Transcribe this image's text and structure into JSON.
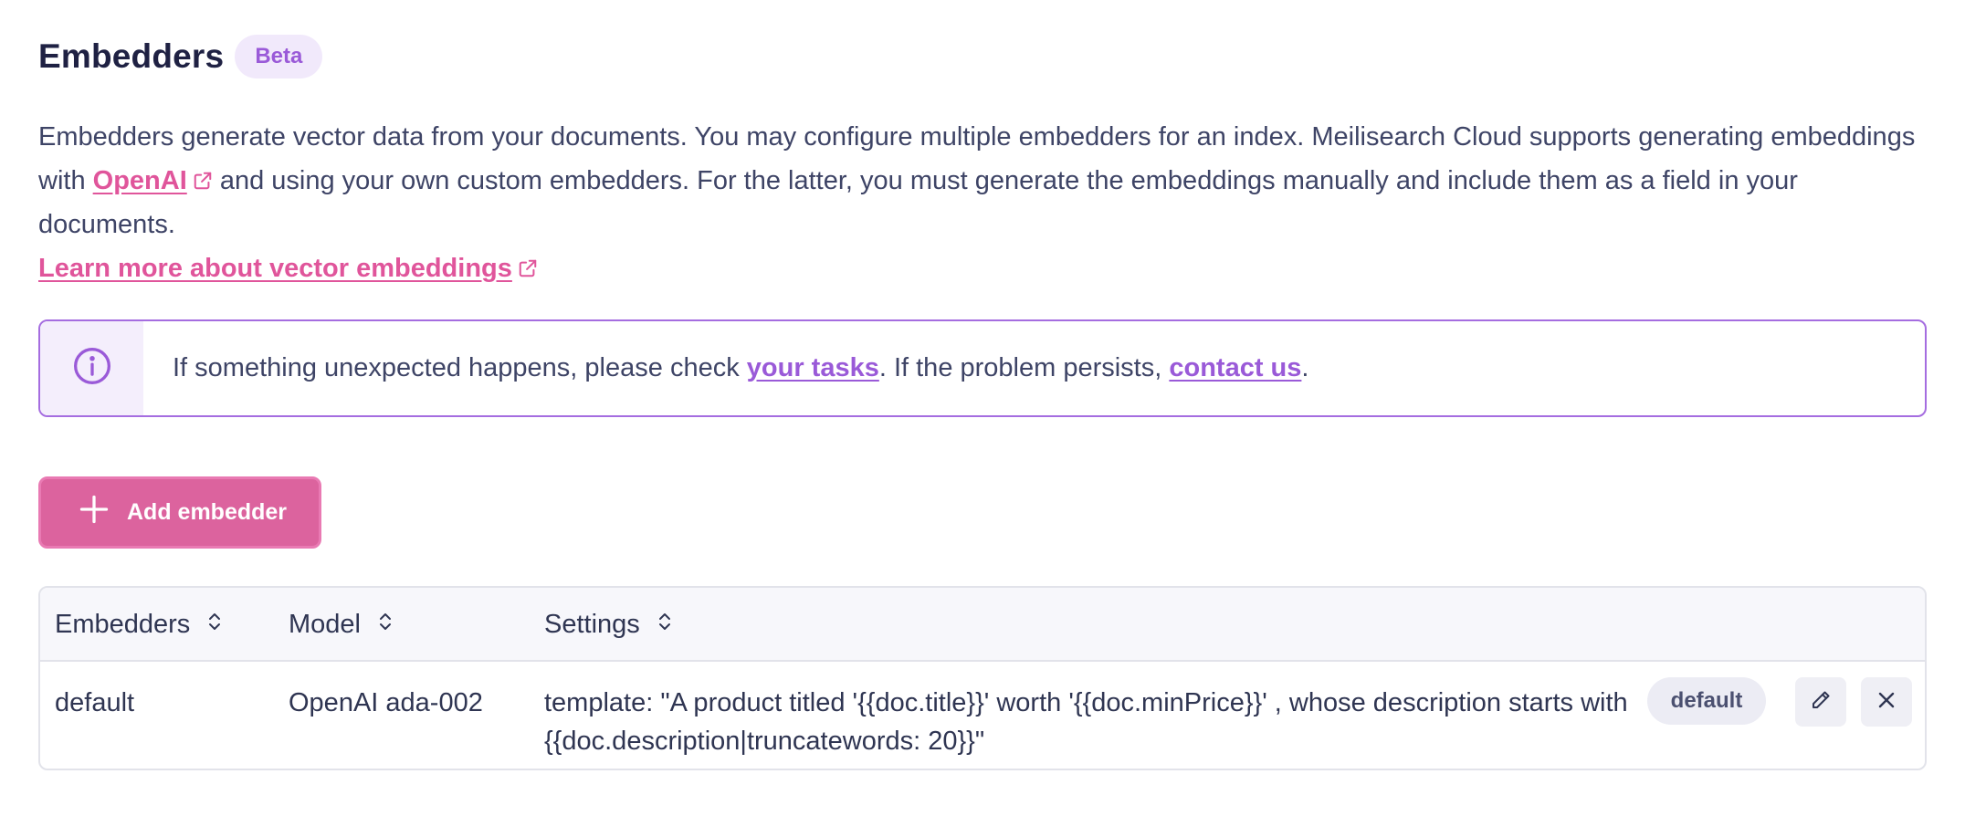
{
  "header": {
    "title": "Embedders",
    "badge": "Beta"
  },
  "description": {
    "part1": "Embedders generate vector data from your documents. You may configure multiple embedders for an index. Meilisearch Cloud supports generating embeddings with ",
    "openai_link": "OpenAI",
    "part2": " and using your own custom embedders. For the latter, you must generate the embeddings manually and include them as a field in your documents."
  },
  "learn_more": {
    "label": "Learn more about vector embeddings"
  },
  "alert": {
    "text1": "If something unexpected happens, please check ",
    "tasks_link": "your tasks",
    "text2": ". If the problem persists, ",
    "contact_link": "contact us",
    "text3": "."
  },
  "add_button": {
    "label": "Add embedder"
  },
  "table": {
    "columns": [
      "Embedders",
      "Model",
      "Settings"
    ],
    "rows": [
      {
        "embedder": "default",
        "model": "OpenAI ada-002",
        "settings": "template: \"A product titled '{{doc.title}}' worth '{{doc.minPrice}}' , whose description starts with {{doc.description|truncatewords: 20}}\"",
        "badge": "default"
      }
    ]
  },
  "colors": {
    "accent_pink": "#dc639e",
    "accent_purple": "#9a5ad8",
    "text": "#2f3552"
  },
  "icons": {
    "external": "external-link-icon",
    "info": "info-icon",
    "plus": "plus-icon",
    "sort": "sort-icon",
    "edit": "pencil-icon",
    "delete": "close-icon"
  }
}
